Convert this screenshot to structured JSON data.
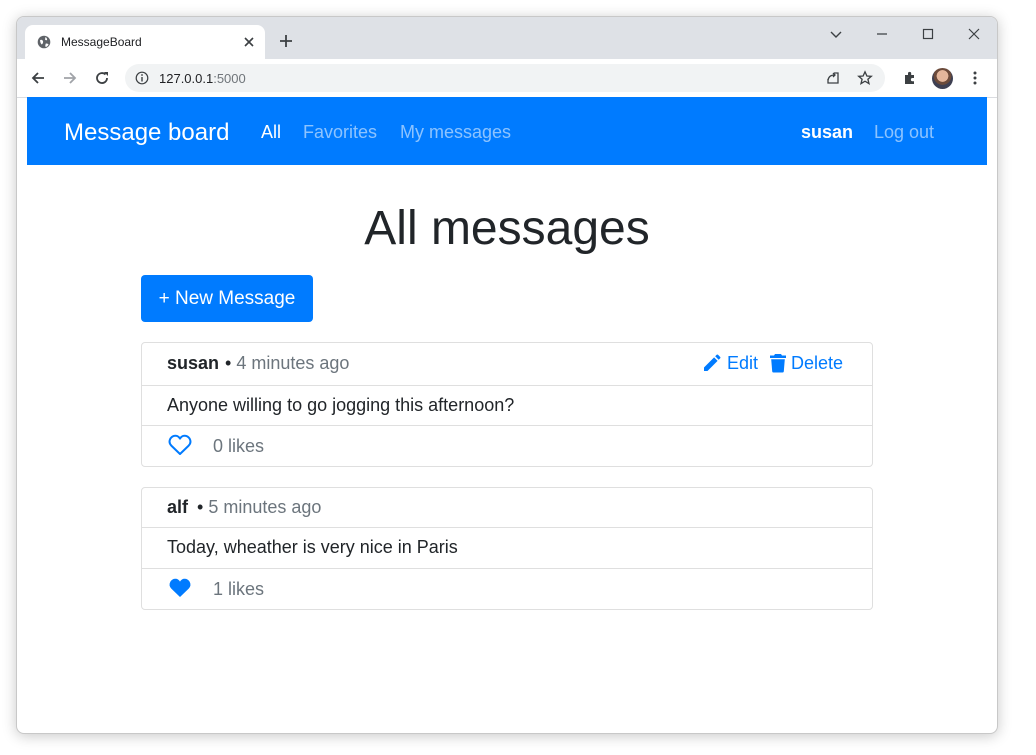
{
  "browser": {
    "tab_title": "MessageBoard",
    "url_host": "127.0.0.1",
    "url_port": ":5000"
  },
  "navbar": {
    "brand": "Message board",
    "links": [
      {
        "label": "All",
        "active": true
      },
      {
        "label": "Favorites",
        "active": false
      },
      {
        "label": "My messages",
        "active": false
      }
    ],
    "user": "susan",
    "logout": "Log out"
  },
  "page": {
    "title": "All messages",
    "new_button": "+ New Message"
  },
  "messages": [
    {
      "author": "susan",
      "separator": "•",
      "time": "4 minutes ago",
      "body": "Anyone willing to go jogging this afternoon?",
      "likes": "0 likes",
      "liked": false,
      "edit_label": "Edit",
      "delete_label": "Delete"
    },
    {
      "author": "alf",
      "separator": "•",
      "time": "5 minutes ago",
      "body": "Today, wheather is very nice in Paris",
      "likes": "1 likes",
      "liked": true
    }
  ],
  "colors": {
    "primary": "#007bff",
    "text": "#212529",
    "muted": "#6c757d",
    "tabstrip": "#dee1e6"
  },
  "icons": [
    "globe-icon",
    "close-icon",
    "plus-icon",
    "chevron-down-icon",
    "minimize-icon",
    "maximize-icon",
    "back-icon",
    "forward-icon",
    "reload-icon",
    "info-icon",
    "share-icon",
    "star-icon",
    "extensions-icon",
    "menu-icon",
    "pencil-icon",
    "trash-icon",
    "heart-outline-icon",
    "heart-filled-icon"
  ]
}
